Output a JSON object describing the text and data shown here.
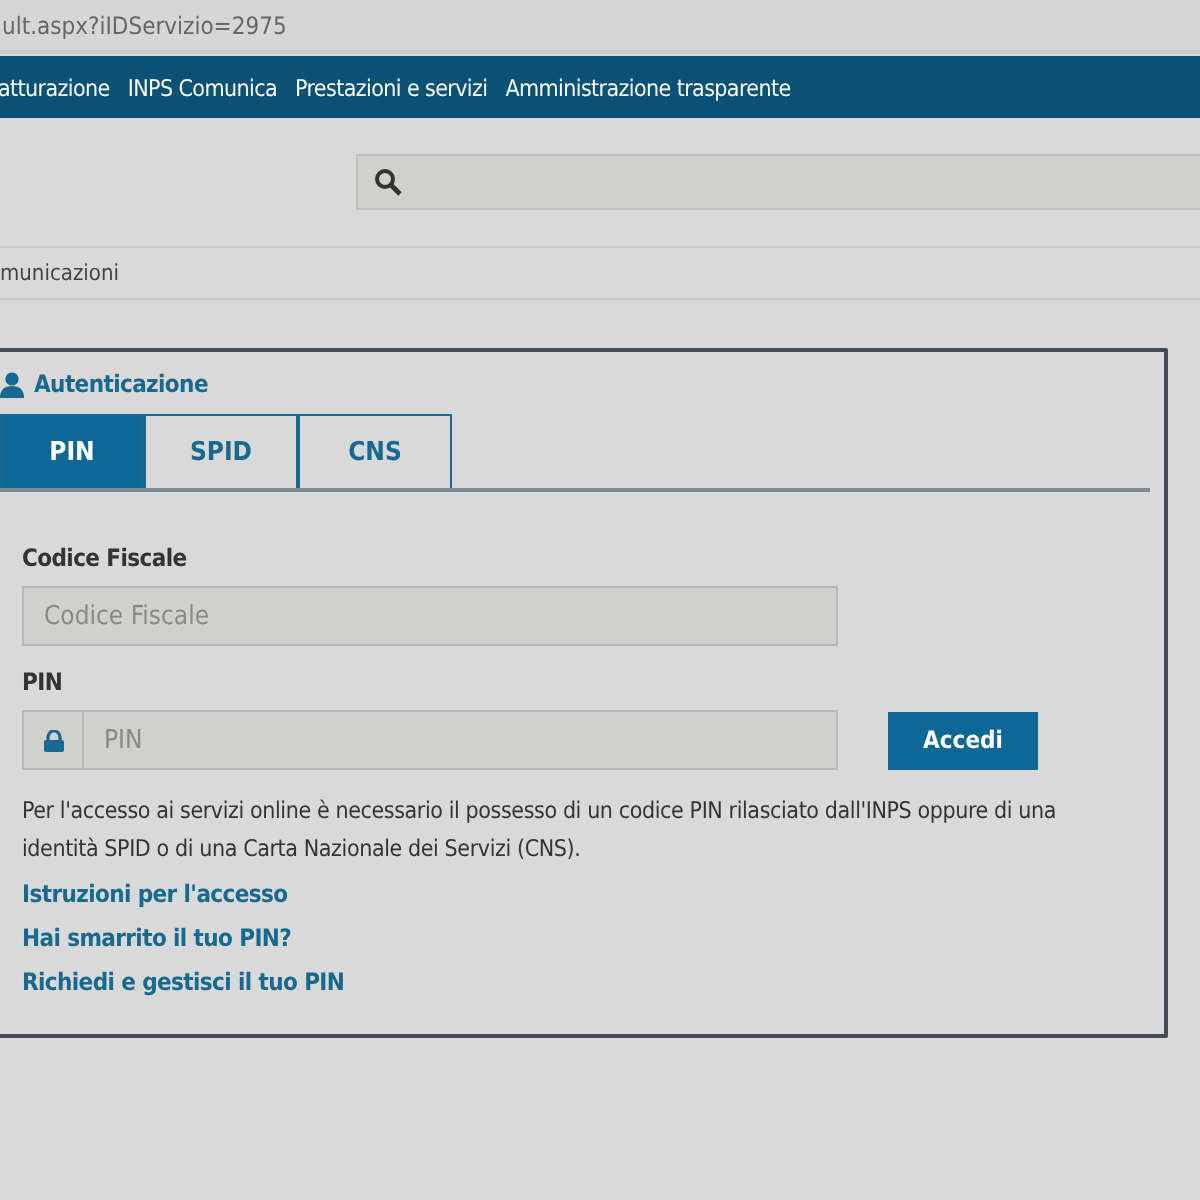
{
  "address_bar": {
    "url": "ult.aspx?iIDServizio=2975"
  },
  "nav": {
    "items": [
      "atturazione",
      "INPS Comunica",
      "Prestazioni e servizi",
      "Amministrazione trasparente"
    ]
  },
  "breadcrumb": {
    "text": "municazioni"
  },
  "login": {
    "title": "Autenticazione",
    "tabs": [
      {
        "label": "PIN",
        "selected": true
      },
      {
        "label": "SPID",
        "selected": false
      },
      {
        "label": "CNS",
        "selected": false
      }
    ],
    "fields": [
      {
        "label": "Codice Fiscale",
        "placeholder": "Codice Fiscale",
        "kind": "plain"
      },
      {
        "label": "PIN",
        "placeholder": "PIN",
        "kind": "lock"
      }
    ],
    "submit": "Accedi",
    "info": "Per l'accesso ai servizi online è necessario il possesso di un codice PIN rilasciato dall'INPS oppure di una identità SPID o di una Carta Nazionale dei Servizi (CNS).",
    "links": [
      "Istruzioni per l'accesso",
      "Hai smarrito il tuo PIN?",
      "Richiedi e gestisci il tuo PIN"
    ]
  }
}
